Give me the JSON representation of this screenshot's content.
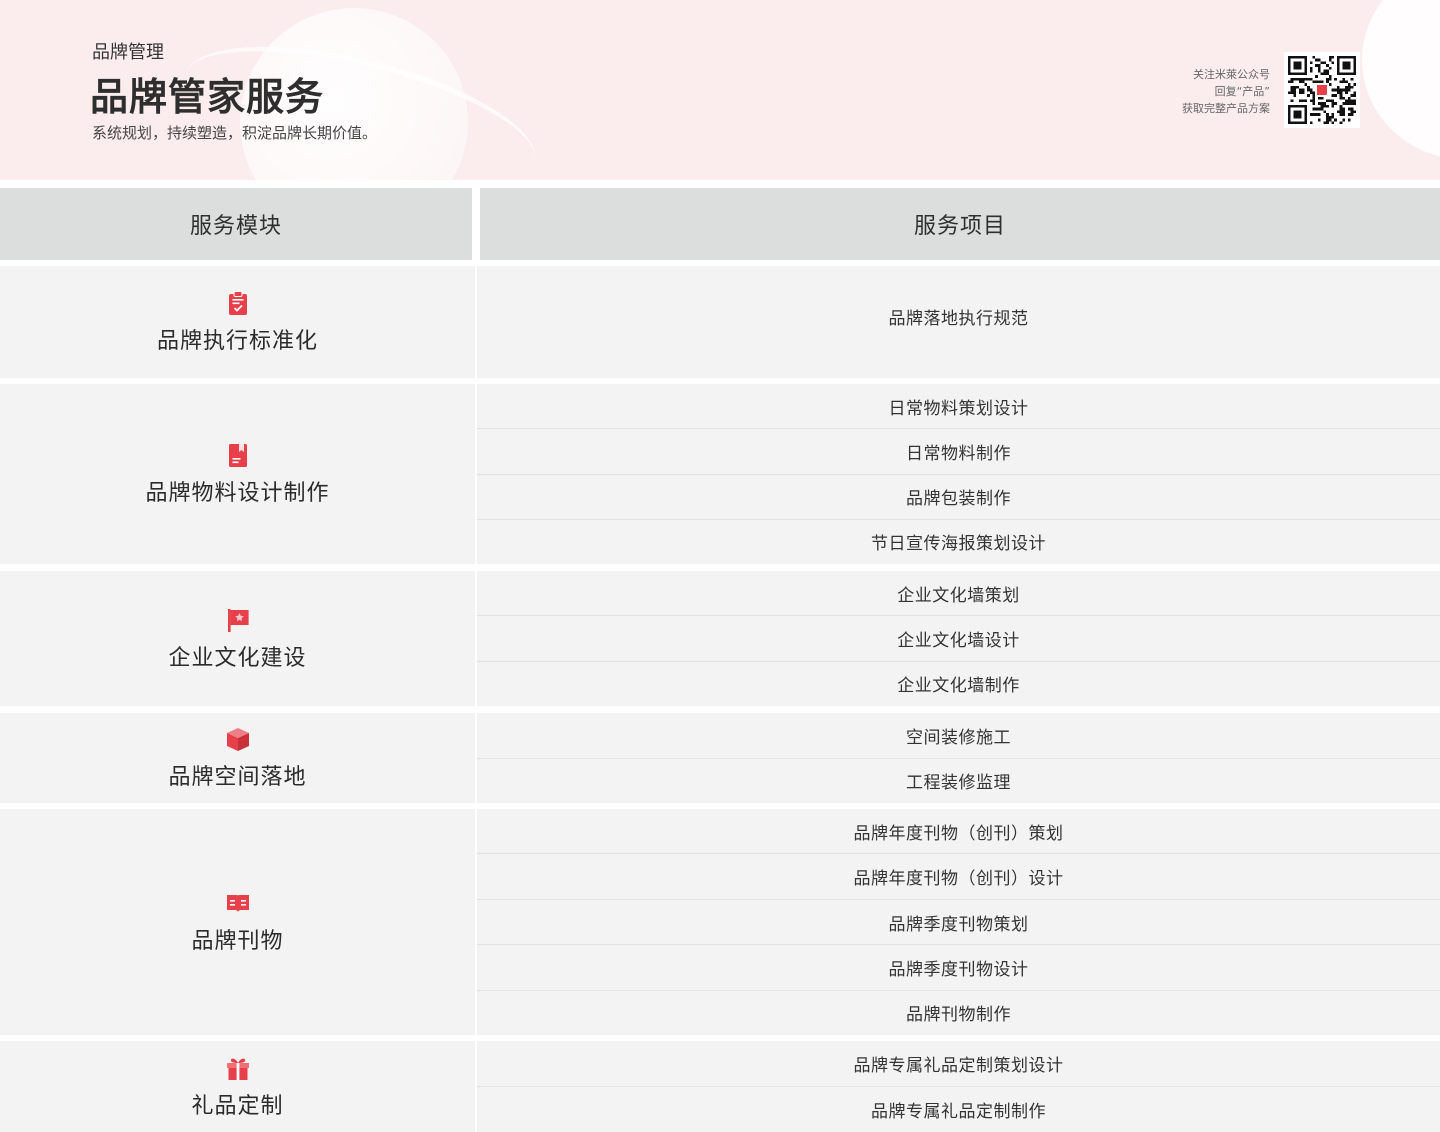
{
  "header": {
    "breadcrumb": "品牌管理",
    "title": "品牌管家服务",
    "subtitle": "系统规划，持续塑造，积淀品牌长期价值。",
    "qr_caption": [
      "关注米萊公众号",
      "回复“产品”",
      "获取完整产品方案"
    ]
  },
  "table": {
    "columns": [
      "服务模块",
      "服务项目"
    ],
    "groups": [
      {
        "module": "品牌执行标准化",
        "icon": "clipboard-check-icon",
        "items": [
          "品牌落地执行规范"
        ]
      },
      {
        "module": "品牌物料设计制作",
        "icon": "bookmark-book-icon",
        "items": [
          "日常物料策划设计",
          "日常物料制作",
          "品牌包装制作",
          "节日宣传海报策划设计"
        ]
      },
      {
        "module": "企业文化建设",
        "icon": "flag-icon",
        "items": [
          "企业文化墙策划",
          "企业文化墙设计",
          "企业文化墙制作"
        ]
      },
      {
        "module": "品牌空间落地",
        "icon": "cube-icon",
        "items": [
          "空间装修施工",
          "工程装修监理"
        ]
      },
      {
        "module": "品牌刊物",
        "icon": "open-book-icon",
        "items": [
          "品牌年度刊物（创刊）策划",
          "品牌年度刊物（创刊）设计",
          "品牌季度刊物策划",
          "品牌季度刊物设计",
          "品牌刊物制作"
        ]
      },
      {
        "module": "礼品定制",
        "icon": "gift-icon",
        "items": [
          "品牌专属礼品定制策划设计",
          "品牌专属礼品定制制作"
        ]
      }
    ]
  },
  "colors": {
    "accent": "#e8404a",
    "header_bg": "#fbeced",
    "th_bg": "#dcdedd",
    "row_bg": "#f2f3f2"
  }
}
